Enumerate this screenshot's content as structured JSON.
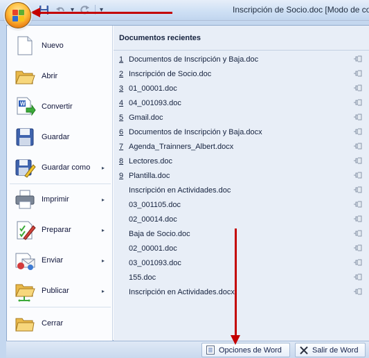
{
  "window": {
    "title": "Inscripción de Socio.doc [Modo de co"
  },
  "menu": {
    "items": [
      {
        "label": "Nuevo",
        "icon": "new-document-icon",
        "has_submenu": false
      },
      {
        "label": "Abrir",
        "icon": "open-folder-icon",
        "has_submenu": false
      },
      {
        "label": "Convertir",
        "icon": "convert-icon",
        "has_submenu": false
      },
      {
        "label": "Guardar",
        "icon": "save-disk-icon",
        "has_submenu": false
      },
      {
        "label": "Guardar como",
        "icon": "save-as-icon",
        "has_submenu": true
      },
      {
        "label": "Imprimir",
        "icon": "printer-icon",
        "has_submenu": true
      },
      {
        "label": "Preparar",
        "icon": "prepare-icon",
        "has_submenu": true
      },
      {
        "label": "Enviar",
        "icon": "send-icon",
        "has_submenu": true
      },
      {
        "label": "Publicar",
        "icon": "publish-icon",
        "has_submenu": true
      },
      {
        "label": "Cerrar",
        "icon": "close-folder-icon",
        "has_submenu": false
      }
    ],
    "submenu_arrow": "▸"
  },
  "recent": {
    "title": "Documentos recientes",
    "items": [
      {
        "num": "1",
        "name": "Documentos de Inscripción y Baja.doc"
      },
      {
        "num": "2",
        "name": "Inscripción de Socio.doc"
      },
      {
        "num": "3",
        "name": "01_00001.doc"
      },
      {
        "num": "4",
        "name": "04_001093.doc"
      },
      {
        "num": "5",
        "name": "Gmail.doc"
      },
      {
        "num": "6",
        "name": "Documentos de Inscripción y Baja.docx"
      },
      {
        "num": "7",
        "name": "Agenda_Trainners_Albert.docx"
      },
      {
        "num": "8",
        "name": "Lectores.doc"
      },
      {
        "num": "9",
        "name": "Plantilla.doc"
      },
      {
        "num": "",
        "name": "Inscripción en Actividades.doc"
      },
      {
        "num": "",
        "name": "03_001105.doc"
      },
      {
        "num": "",
        "name": "02_00014.doc"
      },
      {
        "num": "",
        "name": "Baja de Socio.doc"
      },
      {
        "num": "",
        "name": "02_00001.doc"
      },
      {
        "num": "",
        "name": "03_001093.doc"
      },
      {
        "num": "",
        "name": "155.doc"
      },
      {
        "num": "",
        "name": "Inscripción en Actividades.docx"
      }
    ]
  },
  "footer": {
    "options_label": "Opciones de Word",
    "exit_label": "Salir de Word"
  },
  "qat": {
    "dropdown_glyph": "▾"
  },
  "colors": {
    "annotation_red": "#c40000",
    "menu_bg": "#e8eef7"
  }
}
